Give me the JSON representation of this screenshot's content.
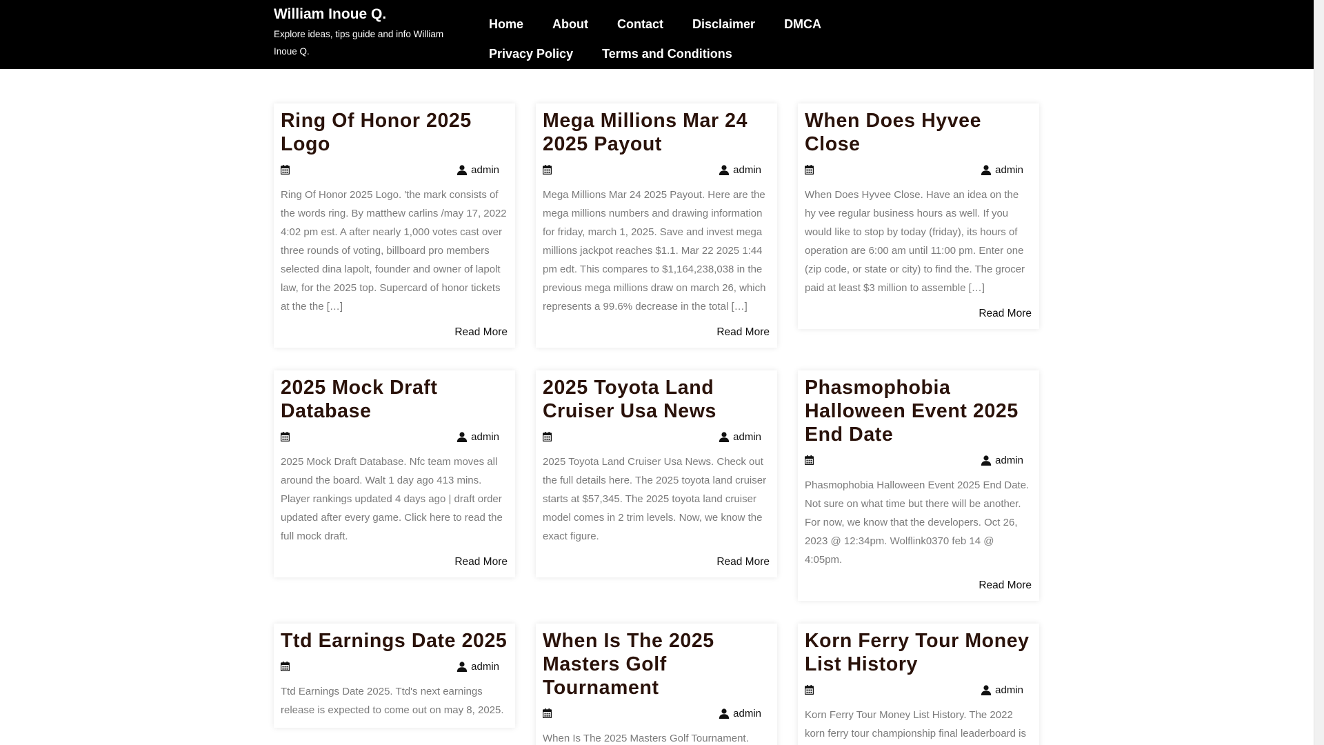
{
  "site": {
    "title": "William Inoue Q.",
    "description": "Explore ideas, tips guide and info William Inoue Q."
  },
  "nav": {
    "items": [
      {
        "label": "Home"
      },
      {
        "label": "About"
      },
      {
        "label": "Contact"
      },
      {
        "label": "Disclaimer"
      },
      {
        "label": "DMCA"
      },
      {
        "label": "Privacy Policy"
      },
      {
        "label": "Terms and Conditions"
      }
    ]
  },
  "posts": [
    {
      "title": "Ring Of Honor 2025 Logo",
      "author": "admin",
      "excerpt": "Ring Of Honor 2025 Logo. 'the mark consists of the words ring. By matthew carlins /may 17, 2022 4:02 pm est. A after nearly 1,000 votes cast over three rounds of voting, billboard pro members selected dina lapolt, founder and owner of lapolt law, for the 2025 top. Supercard of honor tickets at the the […]",
      "read_more": "Read More"
    },
    {
      "title": "Mega Millions Mar 24 2025 Payout",
      "author": "admin",
      "excerpt": "Mega Millions Mar 24 2025 Payout. Here are the mega millions numbers and drawing information for friday, march 1, 2025. Save and invest mega millions jackpot reaches $1.1. Mar 22 2025 1:44 pm edt. This compares to $1,164,238,038 in the previous mega millions draw on march 26, which represents a 99.6% decrease in the total […]",
      "read_more": "Read More"
    },
    {
      "title": "When Does Hyvee Close",
      "author": "admin",
      "excerpt": "When Does Hyvee Close. Have an idea on the hy vee regular business hours as well. If you would like to stop by today (friday), its hours of operation are 6:00 am until 11:00 pm. Enter one (zip code, or state or city) to find the. The grocer paid at least $3 million to assemble […]",
      "read_more": "Read More"
    },
    {
      "title": "2025 Mock Draft Database",
      "author": "admin",
      "excerpt": "2025 Mock Draft Database. Nfc team moves all around the board. Walt 1 day ago 413 mins. Player rankings updated 4 days ago | draft order updated after every game. Click here to read the full mock draft.",
      "read_more": "Read More"
    },
    {
      "title": "2025 Toyota Land Cruiser Usa News",
      "author": "admin",
      "excerpt": "2025 Toyota Land Cruiser Usa News. Check out the full details here. The 2025 toyota land cruiser starts at $57,345. The 2025 toyota land cruiser model comes in 2 trim levels. Now, we know the exact figure.",
      "read_more": "Read More"
    },
    {
      "title": "Phasmophobia Halloween Event 2025 End Date",
      "author": "admin",
      "excerpt": "Phasmophobia Halloween Event 2025 End Date. Not sure on what time but there will be another. For now, we know that the developers. Oct 26, 2023 @ 12:34pm. Wolflink0370 feb 14 @ 4:05pm.",
      "read_more": "Read More"
    },
    {
      "title": "Ttd Earnings Date 2025",
      "author": "admin",
      "excerpt": "Ttd Earnings Date 2025. Ttd's next earnings release is expected to come out on may 8, 2025.",
      "read_more": ""
    },
    {
      "title": "When Is The 2025 Masters Golf Tournament",
      "author": "admin",
      "excerpt": "When Is The 2025 Masters Golf Tournament.",
      "read_more": ""
    },
    {
      "title": "Korn Ferry Tour Money List History",
      "author": "admin",
      "excerpt": "Korn Ferry Tour Money List History. The 2022 korn ferry tour championship final leaderboard is",
      "read_more": ""
    }
  ]
}
